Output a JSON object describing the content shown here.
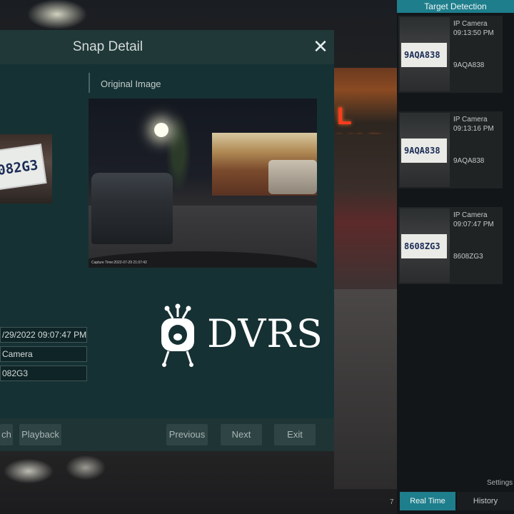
{
  "dialog": {
    "title": "Snap Detail",
    "close_glyph": "✕",
    "section_label": "Original Image",
    "crop_plate_text": "082G3",
    "original_caption": "Capture Time:2022-07-29 21:07:42",
    "info": {
      "time": "/29/2022 09:07:47 PM",
      "camera": "Camera",
      "plate": "082G3"
    },
    "buttons": {
      "search": "ch",
      "playback": "Playback",
      "previous": "Previous",
      "next": "Next",
      "exit": "Exit"
    }
  },
  "watermark": {
    "text": "DVRS"
  },
  "background": {
    "sign_text": "L VAP",
    "channel_number": "7"
  },
  "panel": {
    "title": "Target Detection",
    "detections": [
      {
        "camera": "IP Camera",
        "time": "09:13:50 PM",
        "plate": "9AQA838",
        "image_plate": "9AQA838"
      },
      {
        "camera": "IP Camera",
        "time": "09:13:16 PM",
        "plate": "9AQA838",
        "image_plate": "9AQA838"
      },
      {
        "camera": "IP Camera",
        "time": "09:07:47 PM",
        "plate": "8608ZG3",
        "image_plate": "8608ZG3"
      }
    ],
    "settings_label": "Settings",
    "tabs": {
      "real_time": "Real Time",
      "history": "History"
    }
  },
  "colors": {
    "accent": "#1e7e8c",
    "dialog_bg": "#163133"
  }
}
